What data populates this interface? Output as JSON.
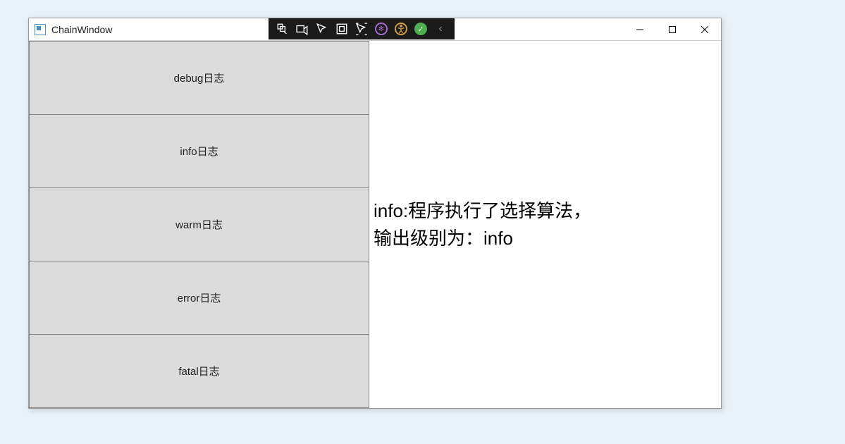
{
  "window": {
    "title": "ChainWindow"
  },
  "buttons": {
    "debug": "debug日志",
    "info": "info日志",
    "warm": "warm日志",
    "error": "error日志",
    "fatal": "fatal日志"
  },
  "output": {
    "text": "info:程序执行了选择算法，\n输出级别为：info"
  }
}
